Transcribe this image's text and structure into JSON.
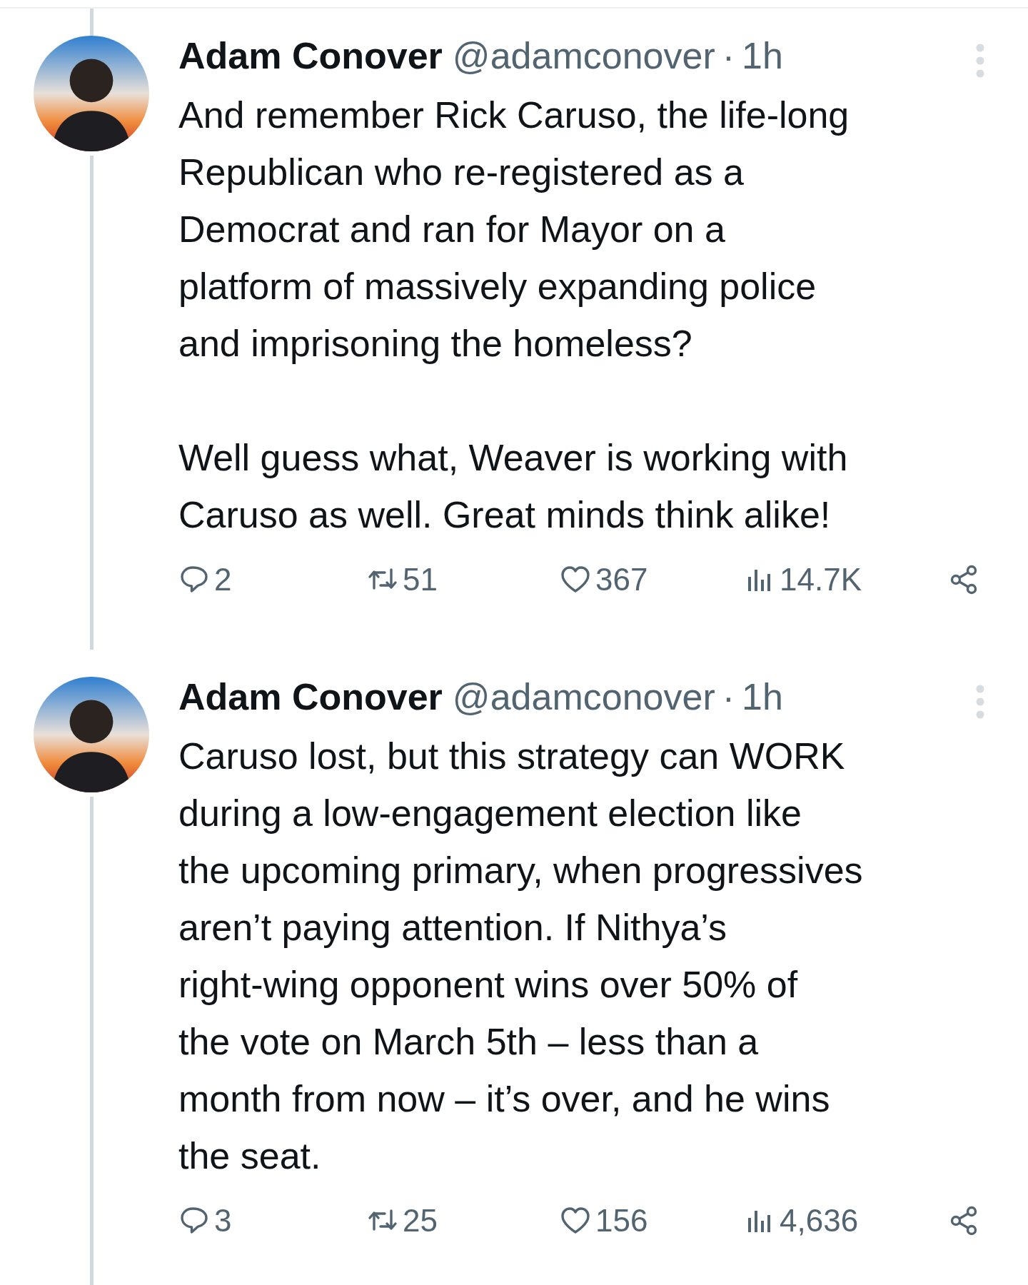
{
  "tweets": [
    {
      "author": "Adam Conover",
      "handle": "@adamconover",
      "separator": "·",
      "time": "1h",
      "paragraphs": [
        "And remember Rick Caruso, the life-long\nRepublican who re-registered as a\nDemocrat and ran for Mayor on a\nplatform of massively expanding police\nand imprisoning the homeless?",
        "Well guess what, Weaver is working with\nCaruso as well. Great minds think alike!"
      ],
      "actions": [
        {
          "kind": "reply",
          "count": "2"
        },
        {
          "kind": "repost",
          "count": "51"
        },
        {
          "kind": "like",
          "count": "367"
        },
        {
          "kind": "views",
          "count": "14.7K"
        },
        {
          "kind": "share"
        }
      ]
    },
    {
      "author": "Adam Conover",
      "handle": "@adamconover",
      "separator": "·",
      "time": "1h",
      "paragraphs": [
        "Caruso lost, but this strategy can WORK\nduring a low-engagement election like\nthe upcoming primary, when progressives\naren’t paying attention. If Nithya’s\nright-wing opponent wins over 50% of\nthe vote on March 5th – less than a\nmonth from now – it’s over, and he wins\nthe seat."
      ],
      "actions": [
        {
          "kind": "reply",
          "count": "3"
        },
        {
          "kind": "repost",
          "count": "25"
        },
        {
          "kind": "like",
          "count": "156"
        },
        {
          "kind": "views",
          "count": "4,636"
        },
        {
          "kind": "share"
        }
      ]
    }
  ]
}
